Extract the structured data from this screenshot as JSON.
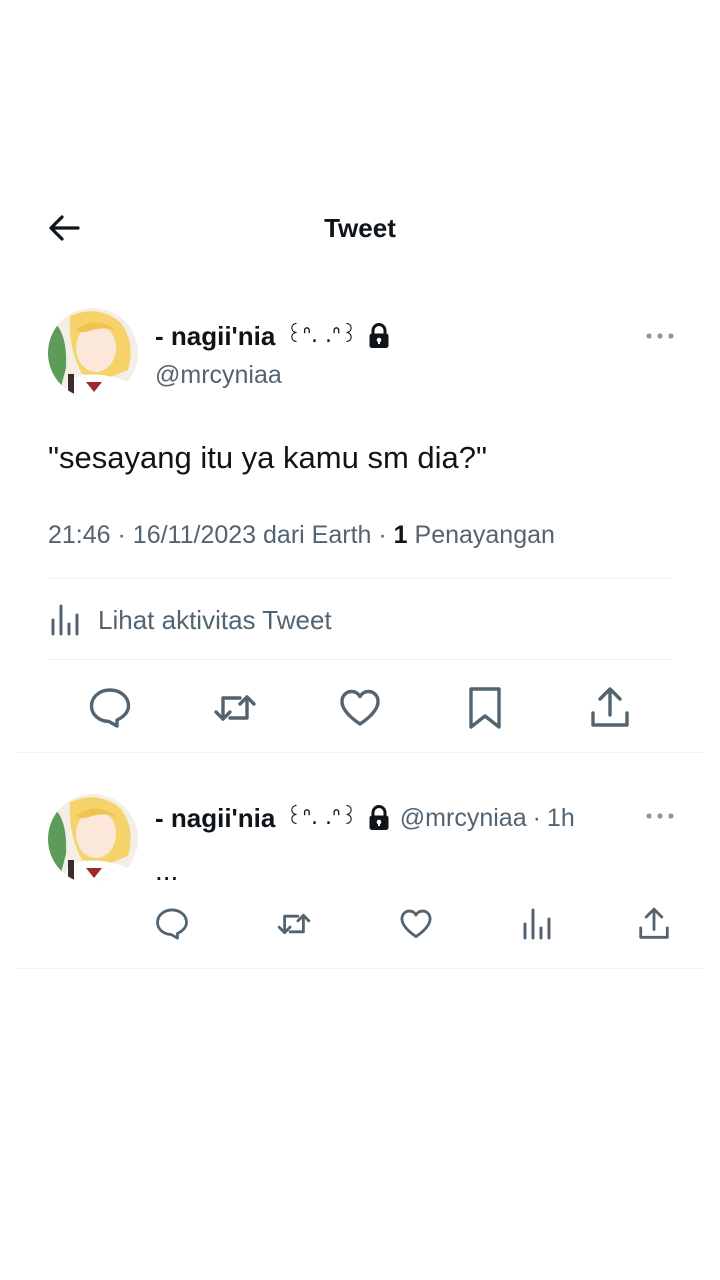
{
  "header": {
    "title": "Tweet"
  },
  "main_tweet": {
    "display_name": "- nagii'nia",
    "name_decoration": "꒰ᐢ. .ᐢ꒱",
    "handle": "@mrcyniaa",
    "text": "\"sesayang itu ya kamu sm dia?\"",
    "time": "21:46",
    "date": "16/11/2023",
    "source": "dari Earth",
    "separator": "·",
    "views_count": "1",
    "views_label": "Penayangan",
    "activity_label": "Lihat aktivitas Tweet"
  },
  "reply_tweet": {
    "display_name": "- nagii'nia",
    "name_decoration": "꒰ᐢ. .ᐢ꒱",
    "handle": "@mrcyniaa",
    "separator": "·",
    "age": "1h",
    "text": "..."
  },
  "colors": {
    "text": "#0f1419",
    "secondary": "#536471",
    "divider": "#eff3f4"
  },
  "icons": [
    "back-arrow-icon",
    "more-icon",
    "lock-icon",
    "reply-icon",
    "retweet-icon",
    "like-icon",
    "bookmark-icon",
    "share-icon",
    "analytics-icon"
  ]
}
